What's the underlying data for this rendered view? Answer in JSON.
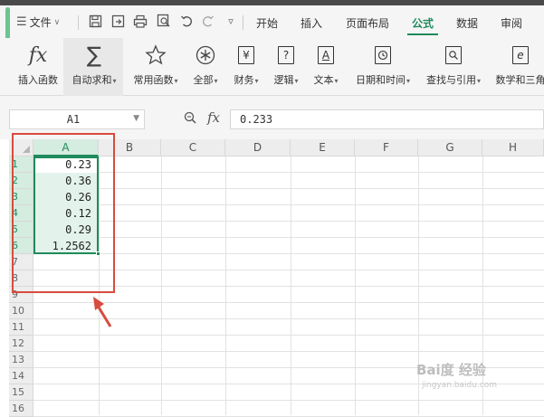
{
  "menu": {
    "file_label": "文件",
    "tabs": [
      {
        "label": "开始",
        "active": false
      },
      {
        "label": "插入",
        "active": false
      },
      {
        "label": "页面布局",
        "active": false
      },
      {
        "label": "公式",
        "active": true
      },
      {
        "label": "数据",
        "active": false
      },
      {
        "label": "审阅",
        "active": false
      }
    ]
  },
  "ribbon": {
    "buttons": [
      {
        "label": "插入函数",
        "icon": "fx-icon"
      },
      {
        "label": "自动求和",
        "icon": "sigma-icon"
      },
      {
        "label": "常用函数",
        "icon": "star-icon"
      },
      {
        "label": "全部",
        "icon": "asterisk-icon"
      },
      {
        "label": "财务",
        "icon": "yen-icon"
      },
      {
        "label": "逻辑",
        "icon": "question-icon"
      },
      {
        "label": "文本",
        "icon": "text-a-icon"
      },
      {
        "label": "日期和时间",
        "icon": "clock-icon"
      },
      {
        "label": "查找与引用",
        "icon": "search-icon"
      },
      {
        "label": "数学和三角",
        "icon": "theta-icon"
      }
    ]
  },
  "formula_bar": {
    "name_box": "A1",
    "fx_label": "fx",
    "formula": "0.233"
  },
  "grid": {
    "columns": [
      "A",
      "B",
      "C",
      "D",
      "E",
      "F",
      "G",
      "H"
    ],
    "rows": [
      "1",
      "2",
      "3",
      "4",
      "5",
      "6",
      "7",
      "8",
      "9",
      "10",
      "11",
      "12",
      "13",
      "14",
      "15",
      "16"
    ],
    "cells_A": [
      "0.23",
      "0.36",
      "0.26",
      "0.12",
      "0.29",
      "1.2562"
    ]
  },
  "watermark": {
    "text": "Bai度 经验",
    "sub": "jingyan.baidu.com"
  },
  "colors": {
    "accent": "#1f8a5b",
    "selection_fill": "#e3f3ec",
    "annotation_red": "#d94b3e"
  }
}
